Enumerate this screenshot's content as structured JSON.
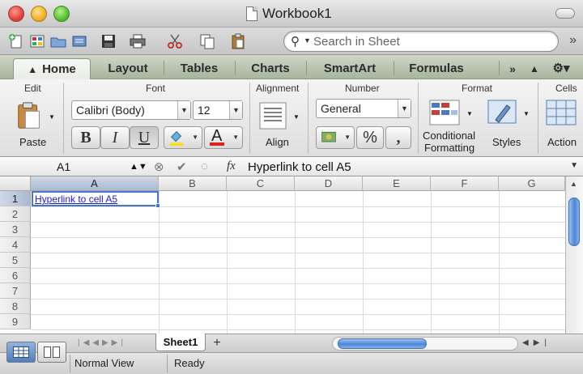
{
  "window": {
    "title": "Workbook1"
  },
  "search": {
    "placeholder": "Search in Sheet"
  },
  "ribbon_tabs": [
    "Home",
    "Layout",
    "Tables",
    "Charts",
    "SmartArt",
    "Formulas"
  ],
  "ribbon_groups": {
    "edit": {
      "label": "Edit",
      "paste_label": "Paste"
    },
    "font": {
      "label": "Font",
      "font_name": "Calibri (Body)",
      "font_size": "12",
      "bold": "B",
      "italic": "I",
      "underline": "U",
      "font_color_glyph": "A"
    },
    "alignment": {
      "label": "Alignment",
      "align_label": "Align"
    },
    "number": {
      "label": "Number",
      "format": "General",
      "percent": "%",
      "comma": ","
    },
    "format": {
      "label": "Format",
      "conditional_line1": "Conditional",
      "conditional_line2": "Formatting",
      "styles_label": "Styles"
    },
    "cells": {
      "label": "Cells",
      "actions_label": "Action"
    }
  },
  "formula_bar": {
    "cell_ref": "A1",
    "fx": "fx",
    "value": "Hyperlink to cell A5"
  },
  "columns": [
    "A",
    "B",
    "C",
    "D",
    "E",
    "F",
    "G"
  ],
  "rows": [
    "1",
    "2",
    "3",
    "4",
    "5",
    "6",
    "7",
    "8",
    "9"
  ],
  "cells": {
    "A1": "Hyperlink to cell A5"
  },
  "sheets": [
    "Sheet1"
  ],
  "add_sheet": "+",
  "status": {
    "view": "Normal View",
    "state": "Ready"
  },
  "colors": {
    "link": "#1a1ad8",
    "selection": "#4677c9",
    "ribbon_tab_bg": "#a8b59f"
  }
}
